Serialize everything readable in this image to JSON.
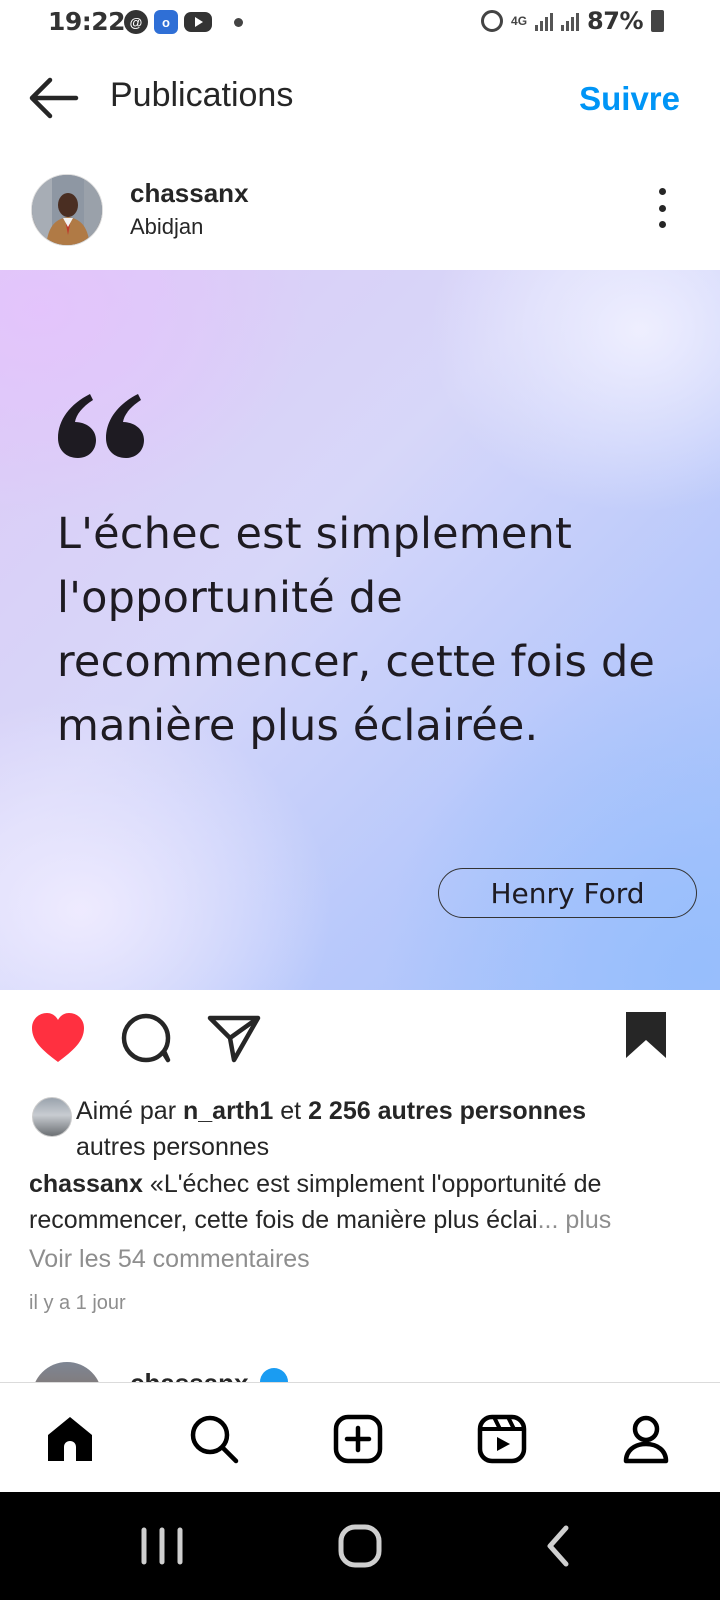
{
  "status_bar": {
    "time": "19:22",
    "network": "4G",
    "battery": "87%",
    "notification_icons": [
      "threads-icon",
      "outlook-icon",
      "youtube-icon"
    ]
  },
  "header": {
    "title": "Publications",
    "follow_label": "Suivre"
  },
  "post": {
    "username": "chassanx",
    "location": "Abidjan",
    "image": {
      "quote": "L'échec est simplement l'opportunité de recommencer, cette fois de manière plus éclairée.",
      "author": "Henry Ford"
    },
    "likes": {
      "prefix": "Aimé par",
      "first_liker": "n_arth1",
      "conjunction": "et",
      "others": "2 256 autres personnes",
      "overflow_line": "autres personnes"
    },
    "caption": {
      "username": "chassanx",
      "text": "«L'échec est simplement l'opportunité de recommencer, cette fois de manière plus éclai",
      "ellipsis": "...",
      "more_label": "plus"
    },
    "comments_link": "Voir les 54 commentaires",
    "timestamp": "il y a 1 jour",
    "liked": true,
    "saved": true
  },
  "next_post": {
    "username": "chassanx"
  },
  "colors": {
    "accent": "#0095f6",
    "like": "#ff3040",
    "text": "#262626",
    "secondary_text": "#8e8e8e",
    "verified": "#1a9cf2"
  }
}
